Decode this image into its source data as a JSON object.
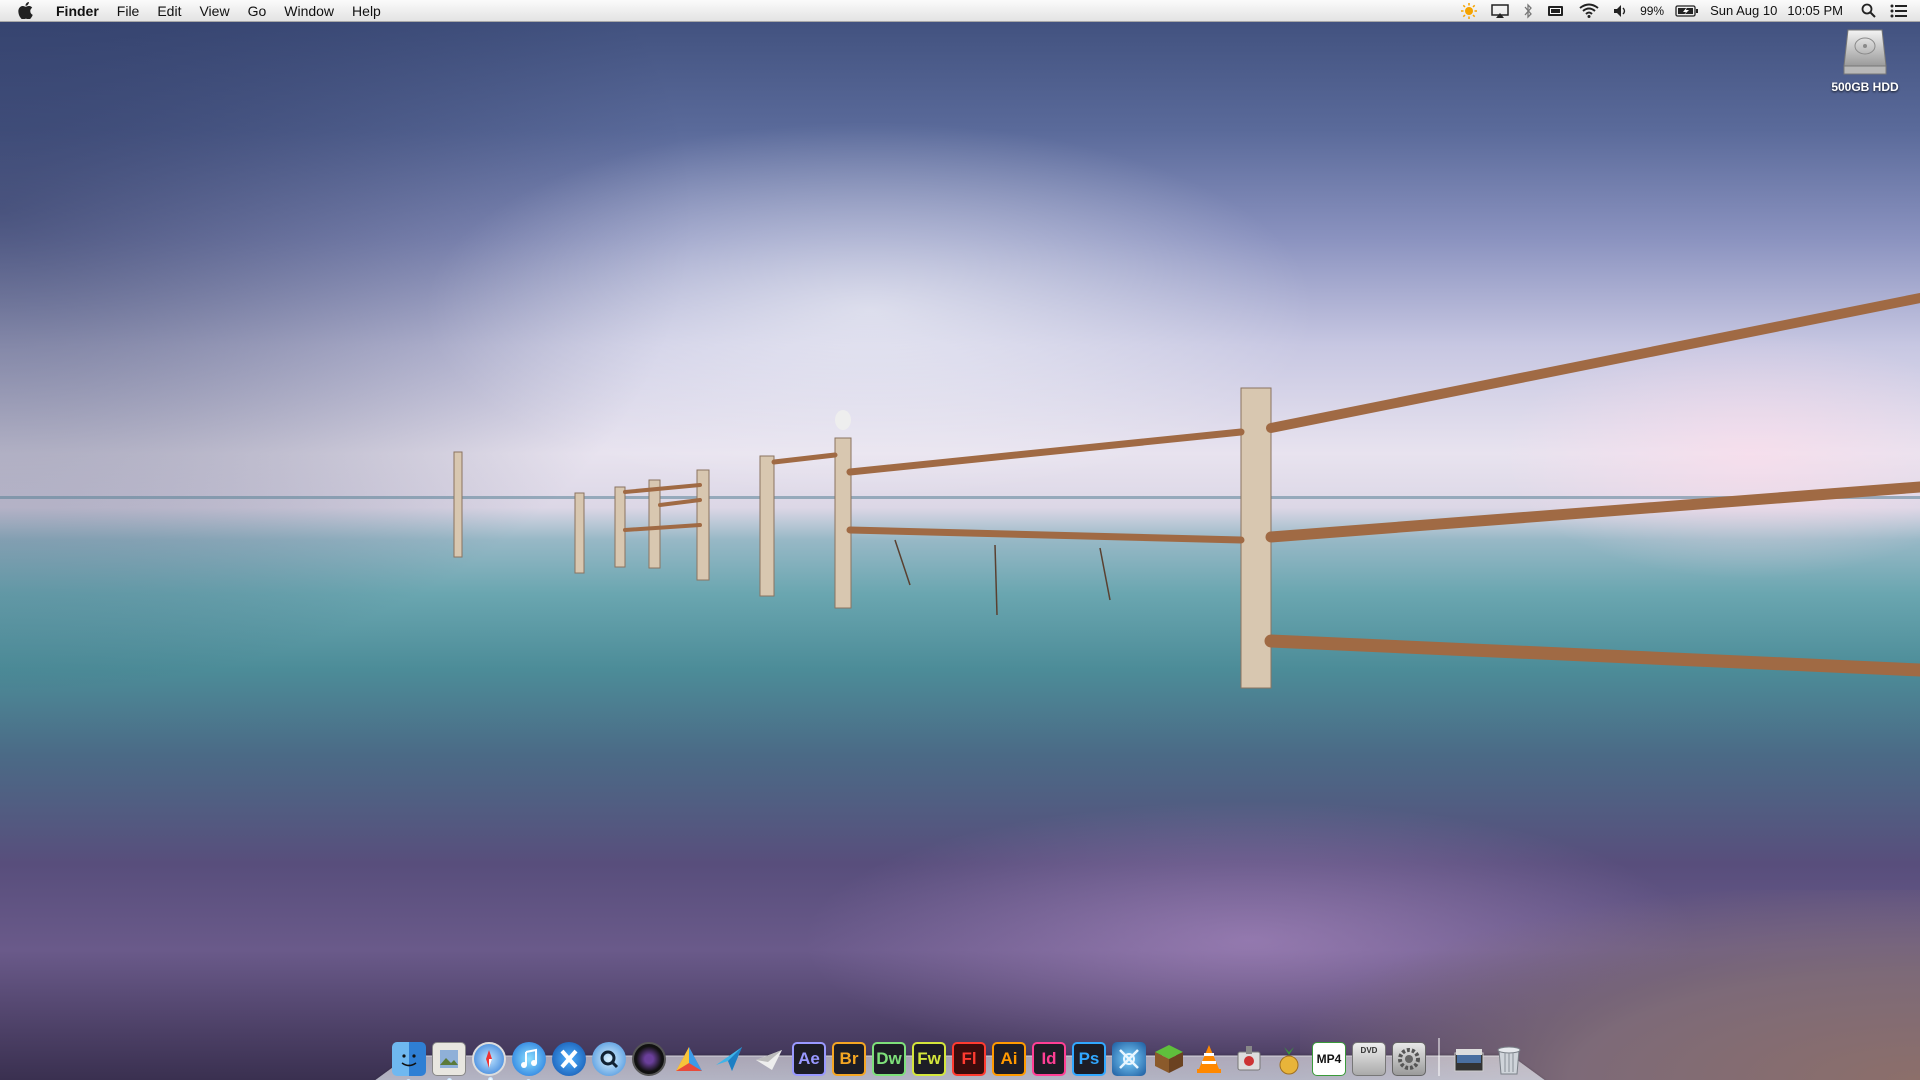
{
  "menubar": {
    "app_name": "Finder",
    "menus": [
      "File",
      "Edit",
      "View",
      "Go",
      "Window",
      "Help"
    ],
    "battery_percent": "99%",
    "date": "Sun Aug 10",
    "time": "10:05 PM"
  },
  "desktop": {
    "disk_label": "500GB HDD"
  },
  "dock": {
    "apps": [
      {
        "name": "finder-icon"
      },
      {
        "name": "preview-icon"
      },
      {
        "name": "safari-icon"
      },
      {
        "name": "itunes-icon"
      },
      {
        "name": "x-app-icon"
      },
      {
        "name": "quicktime-icon"
      },
      {
        "name": "camera-lens-icon"
      },
      {
        "name": "colorful-triangle-icon"
      },
      {
        "name": "blue-arrow-icon"
      },
      {
        "name": "paper-plane-icon"
      },
      {
        "name": "after-effects-icon",
        "label": "Ae",
        "color": "#9999ff"
      },
      {
        "name": "bridge-icon",
        "label": "Br",
        "color": "#f5a623"
      },
      {
        "name": "dreamweaver-icon",
        "label": "Dw",
        "color": "#7ee07a"
      },
      {
        "name": "fireworks-icon",
        "label": "Fw",
        "color": "#d4e63b"
      },
      {
        "name": "flash-icon",
        "label": "Fl",
        "color": "#ff3b30"
      },
      {
        "name": "illustrator-icon",
        "label": "Ai",
        "color": "#ff9a00"
      },
      {
        "name": "indesign-icon",
        "label": "Id",
        "color": "#ff3f94"
      },
      {
        "name": "photoshop-icon",
        "label": "Ps",
        "color": "#31a8ff"
      },
      {
        "name": "blue-tool-icon"
      },
      {
        "name": "minecraft-icon"
      },
      {
        "name": "vlc-icon"
      },
      {
        "name": "utility-icon"
      },
      {
        "name": "pineapple-icon"
      },
      {
        "name": "mp4-converter-icon",
        "label": "MP4"
      },
      {
        "name": "dvd-player-icon",
        "label": "DVD"
      },
      {
        "name": "system-preferences-icon"
      }
    ],
    "trailing": [
      {
        "name": "downloads-stack-icon"
      },
      {
        "name": "trash-icon"
      }
    ]
  }
}
